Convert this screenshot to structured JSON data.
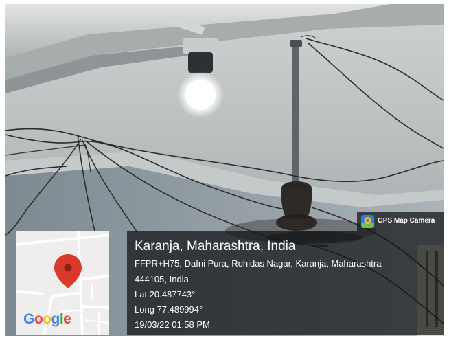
{
  "badge": {
    "label": "GPS Map Camera"
  },
  "map": {
    "logo_text": "Google"
  },
  "location": {
    "title": "Karanja, Maharashtra, India",
    "address_line_1": "FFPR+H75, Dafni Pura, Rohidas Nagar, Karanja, Maharashtra",
    "address_line_2": "444105, India",
    "latitude": "Lat 20.487743°",
    "longitude": "Long 77.489994°",
    "datetime": "19/03/22 01:58 PM"
  },
  "colors": {
    "overlay": "#0f1114",
    "pin": "#d93a2b",
    "badge_icon": "#2f7fd6"
  }
}
